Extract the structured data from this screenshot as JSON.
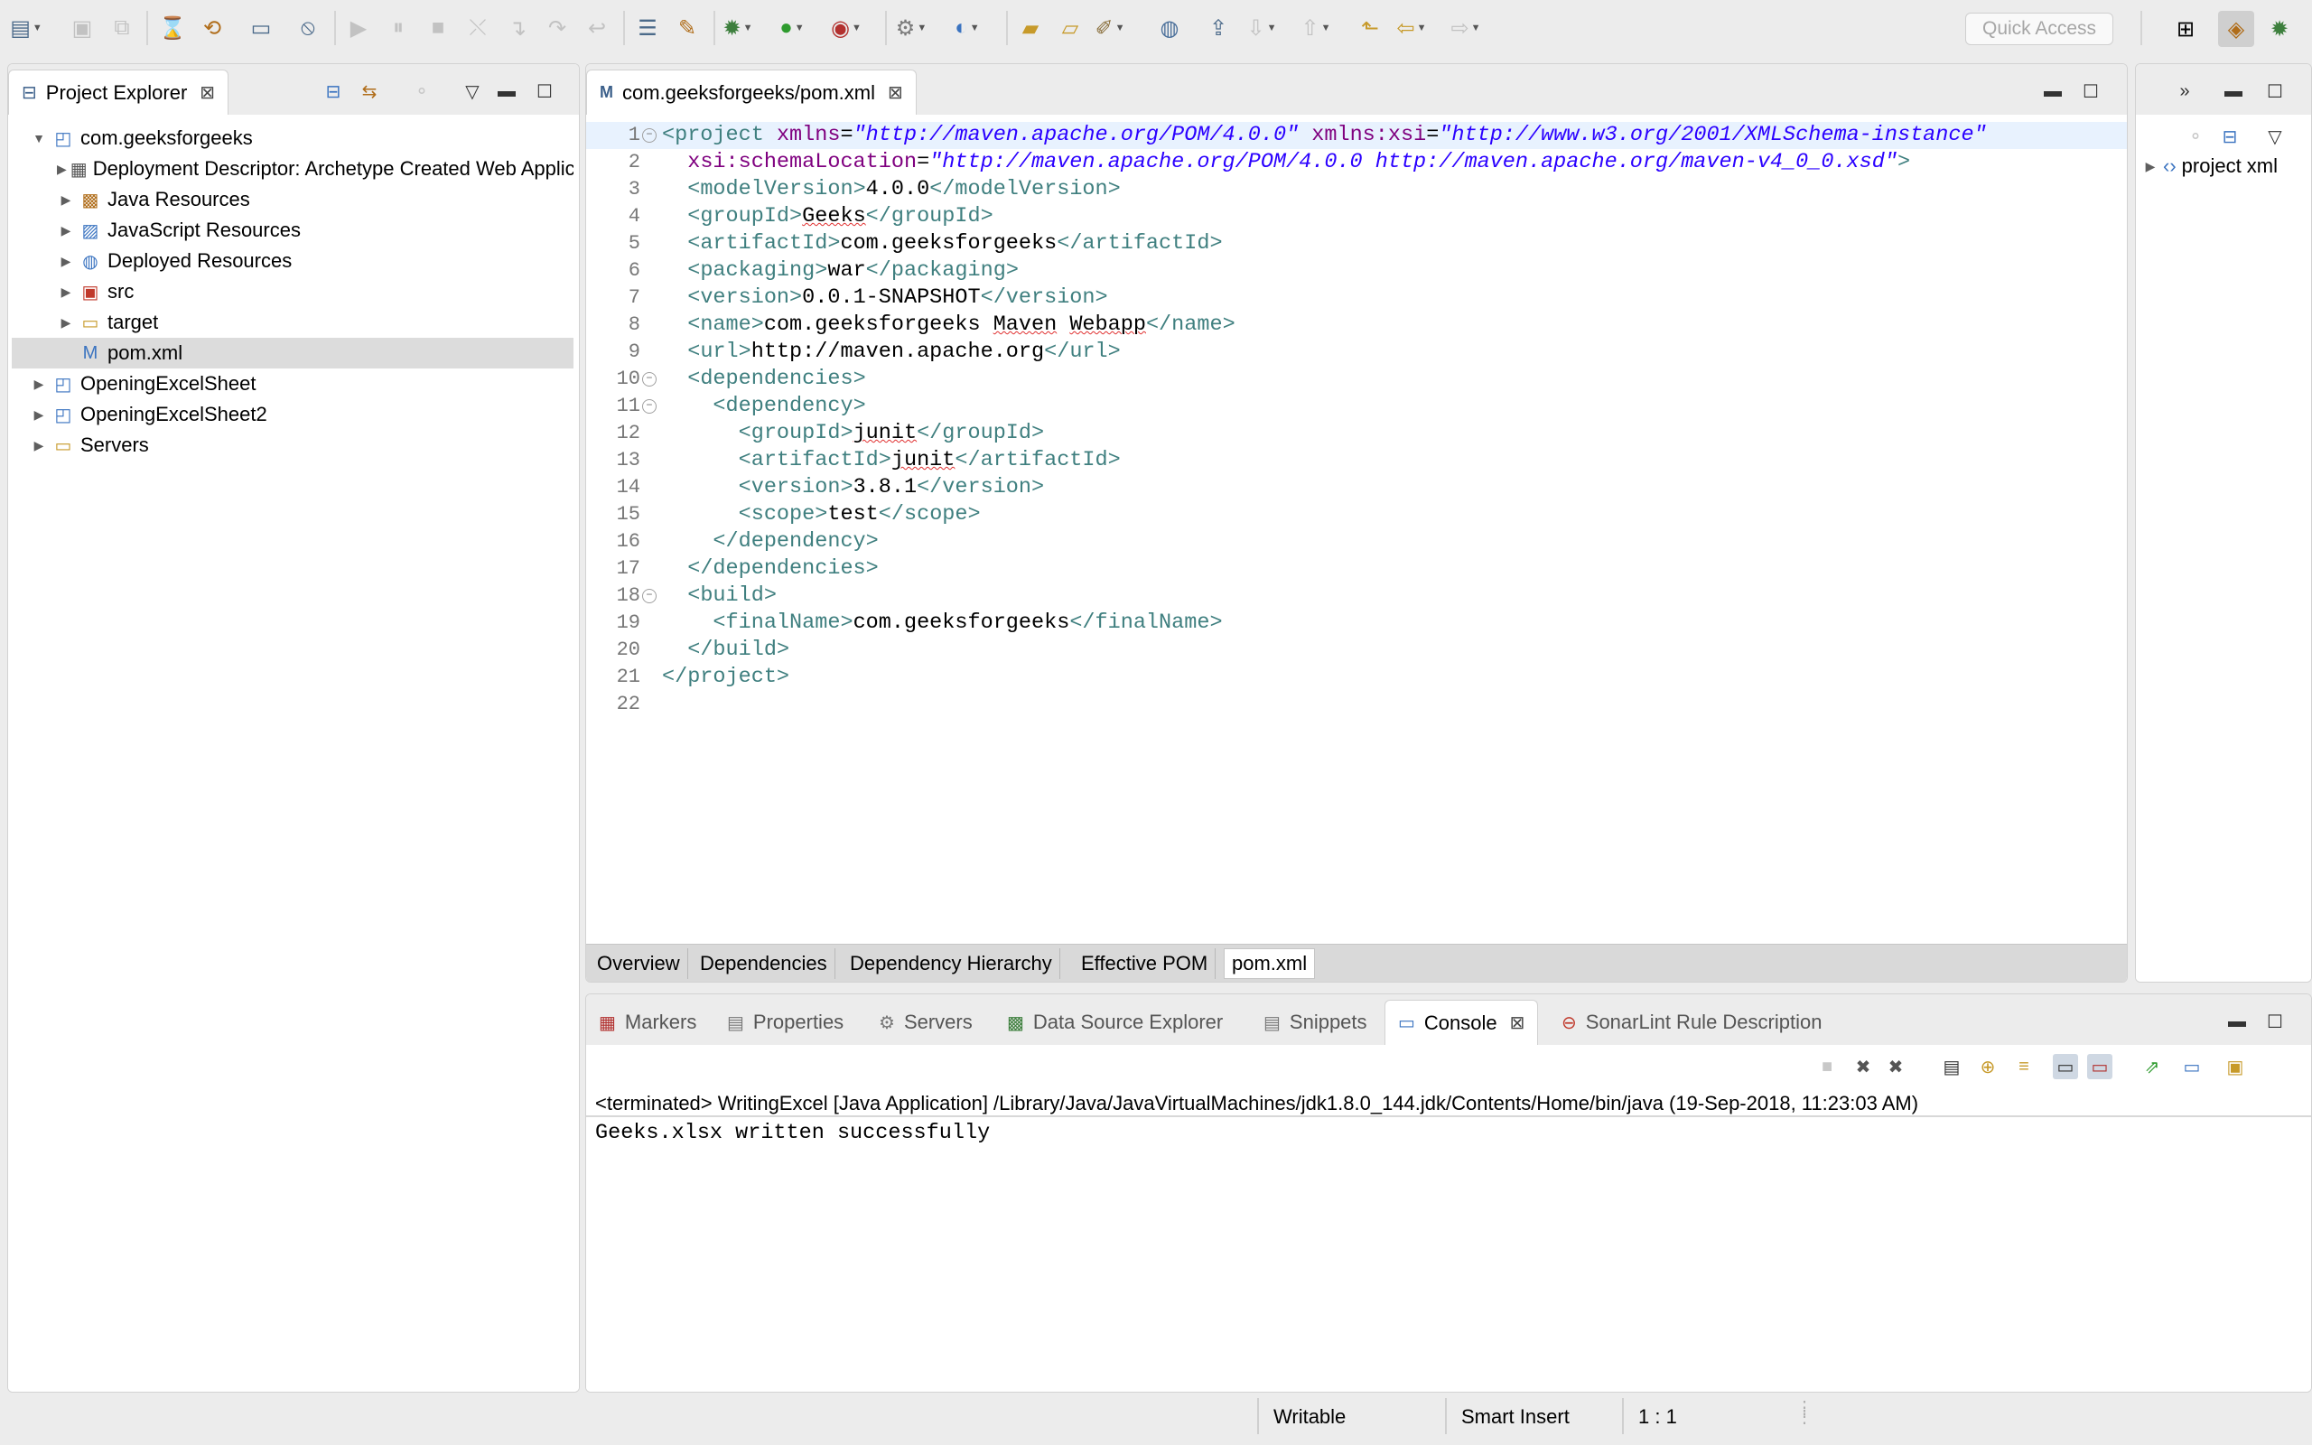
{
  "toolbar": {
    "quick_access_placeholder": "Quick Access"
  },
  "project_explorer": {
    "title": "Project Explorer",
    "tree": [
      {
        "label": "com.geeksforgeeks",
        "indent": 0,
        "expanded": true,
        "icon": "maven-project-icon"
      },
      {
        "label": "Deployment Descriptor: Archetype Created Web Application",
        "indent": 1,
        "expanded": false,
        "icon": "deployment-descriptor-icon"
      },
      {
        "label": "Java Resources",
        "indent": 1,
        "expanded": false,
        "icon": "java-resources-icon"
      },
      {
        "label": "JavaScript Resources",
        "indent": 1,
        "expanded": false,
        "icon": "javascript-resources-icon"
      },
      {
        "label": "Deployed Resources",
        "indent": 1,
        "expanded": false,
        "icon": "deployed-resources-icon"
      },
      {
        "label": "src",
        "indent": 1,
        "expanded": false,
        "icon": "folder-error-icon"
      },
      {
        "label": "target",
        "indent": 1,
        "expanded": false,
        "icon": "folder-icon"
      },
      {
        "label": "pom.xml",
        "indent": 1,
        "expanded": null,
        "icon": "pom-file-icon",
        "selected": true
      },
      {
        "label": "OpeningExcelSheet",
        "indent": 0,
        "expanded": false,
        "icon": "maven-project-icon"
      },
      {
        "label": "OpeningExcelSheet2",
        "indent": 0,
        "expanded": false,
        "icon": "maven-project-icon"
      },
      {
        "label": "Servers",
        "indent": 0,
        "expanded": false,
        "icon": "folder-icon"
      }
    ]
  },
  "editor": {
    "tab_title": "com.geeksforgeeks/pom.xml",
    "bottom_tabs": [
      "Overview",
      "Dependencies",
      "Dependency Hierarchy",
      "Effective POM",
      "pom.xml"
    ],
    "active_bottom_tab": "pom.xml",
    "line_numbers": [
      "1",
      "2",
      "3",
      "4",
      "5",
      "6",
      "7",
      "8",
      "9",
      "10",
      "11",
      "12",
      "13",
      "14",
      "15",
      "16",
      "17",
      "18",
      "19",
      "20",
      "21",
      "22"
    ],
    "lines": [
      "<project xmlns=\"http://maven.apache.org/POM/4.0.0\" xmlns:xsi=\"http://www.w3.org/2001/XMLSchema-instance\"",
      "  xsi:schemaLocation=\"http://maven.apache.org/POM/4.0.0 http://maven.apache.org/maven-v4_0_0.xsd\">",
      "  <modelVersion>4.0.0</modelVersion>",
      "  <groupId>Geeks</groupId>",
      "  <artifactId>com.geeksforgeeks</artifactId>",
      "  <packaging>war</packaging>",
      "  <version>0.0.1-SNAPSHOT</version>",
      "  <name>com.geeksforgeeks Maven Webapp</name>",
      "  <url>http://maven.apache.org</url>",
      "  <dependencies>",
      "    <dependency>",
      "      <groupId>junit</groupId>",
      "      <artifactId>junit</artifactId>",
      "      <version>3.8.1</version>",
      "      <scope>test</scope>",
      "    </dependency>",
      "  </dependencies>",
      "  <build>",
      "    <finalName>com.geeksforgeeks</finalName>",
      "  </build>",
      "</project>",
      ""
    ]
  },
  "outline": {
    "item": "project xml"
  },
  "console_panel": {
    "tabs": [
      {
        "label": "Markers",
        "icon": "markers-icon"
      },
      {
        "label": "Properties",
        "icon": "properties-icon"
      },
      {
        "label": "Servers",
        "icon": "servers-icon"
      },
      {
        "label": "Data Source Explorer",
        "icon": "data-source-icon"
      },
      {
        "label": "Snippets",
        "icon": "snippets-icon"
      },
      {
        "label": "Console",
        "icon": "console-icon",
        "active": true
      },
      {
        "label": "SonarLint Rule Description",
        "icon": "sonarlint-icon"
      }
    ],
    "header": "<terminated> WritingExcel [Java Application] /Library/Java/JavaVirtualMachines/jdk1.8.0_144.jdk/Contents/Home/bin/java (19-Sep-2018, 11:23:03 AM)",
    "output": "Geeks.xlsx written successfully"
  },
  "statusbar": {
    "writable": "Writable",
    "insert_mode": "Smart Insert",
    "position": "1 : 1"
  }
}
